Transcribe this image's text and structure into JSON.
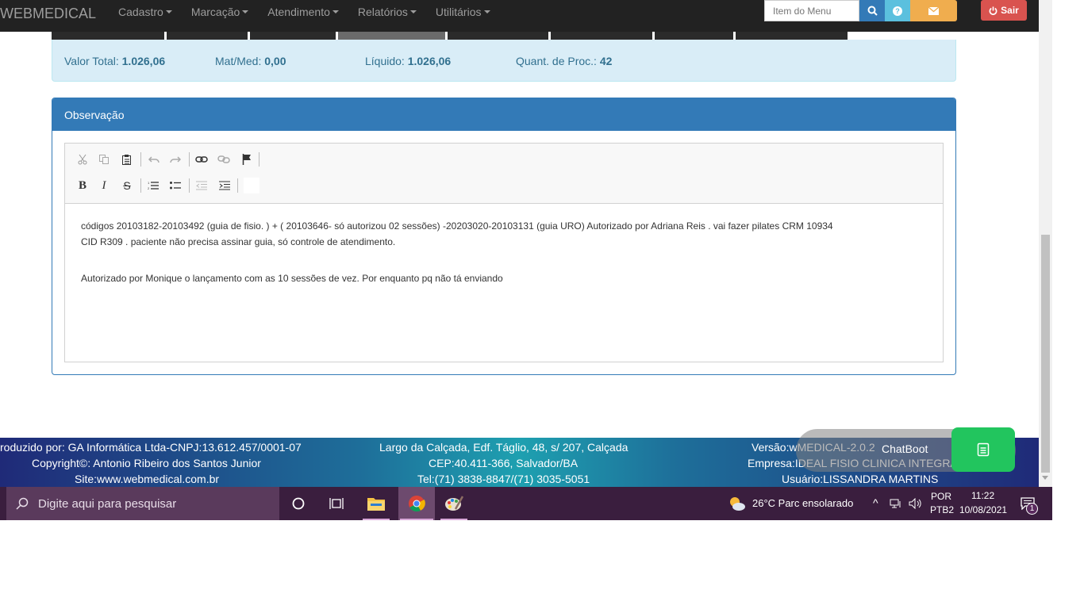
{
  "navbar": {
    "brand": "WEBMEDICAL",
    "menu": [
      {
        "label": "Cadastro"
      },
      {
        "label": "Marcação"
      },
      {
        "label": "Atendimento"
      },
      {
        "label": "Relatórios"
      },
      {
        "label": "Utilitários"
      }
    ],
    "search_placeholder": "Item do Menu",
    "logout_label": "Sair",
    "help_glyph": "?"
  },
  "totals": {
    "valor_total_label": "Valor Total:",
    "valor_total": "1.026,06",
    "matmed_label": "Mat/Med:",
    "matmed": "0,00",
    "liquido_label": "Líquido:",
    "liquido": "1.026,06",
    "quant_label": "Quant. de Proc.:",
    "quant": "42"
  },
  "observacao": {
    "title": "Observação",
    "line1": "códigos 20103182-20103492 (guia de fisio. ) + ( 20103646- só autorizou 02 sessões) -20203020-20103131 (guia URO) Autorizado por Adriana Reis . vai fazer pilates  CRM 10934",
    "line2": "CID  R309  . paciente não precisa assinar guia, só controle de atendimento.",
    "line3": "Autorizado por Monique o lançamento com as 10 sessões de vez. Por enquanto pq não tá enviando"
  },
  "footer": {
    "produzido": "roduzido por: GA Informática Ltda-CNPJ:13.612.457/0001-07",
    "copyright": "Copyright©: Antonio Ribeiro dos Santos Junior",
    "site": "Site:www.webmedical.com.br",
    "endereco": "Largo da Calçada, Edf. Táglio, 48, s/ 207, Calçada",
    "cep": "CEP:40.411-366, Salvador/BA",
    "tel": "Tel:(71) 3838-8847/(71) 3035-5051",
    "versao": "Versão:wMEDICAL-2.0.2",
    "empresa": "Empresa:IDEAL FISIO CLINICA INTEGRA",
    "usuario": "Usuário:LISSANDRA MARTINS"
  },
  "chatbot": {
    "label": "ChatBoot"
  },
  "taskbar": {
    "search_placeholder": "Digite aqui para pesquisar",
    "weather": "26°C  Parc ensolarado",
    "lang_top": "POR",
    "lang_bottom": "PTB2",
    "time": "11:22",
    "date": "10/08/2021",
    "notification_count": "1"
  }
}
